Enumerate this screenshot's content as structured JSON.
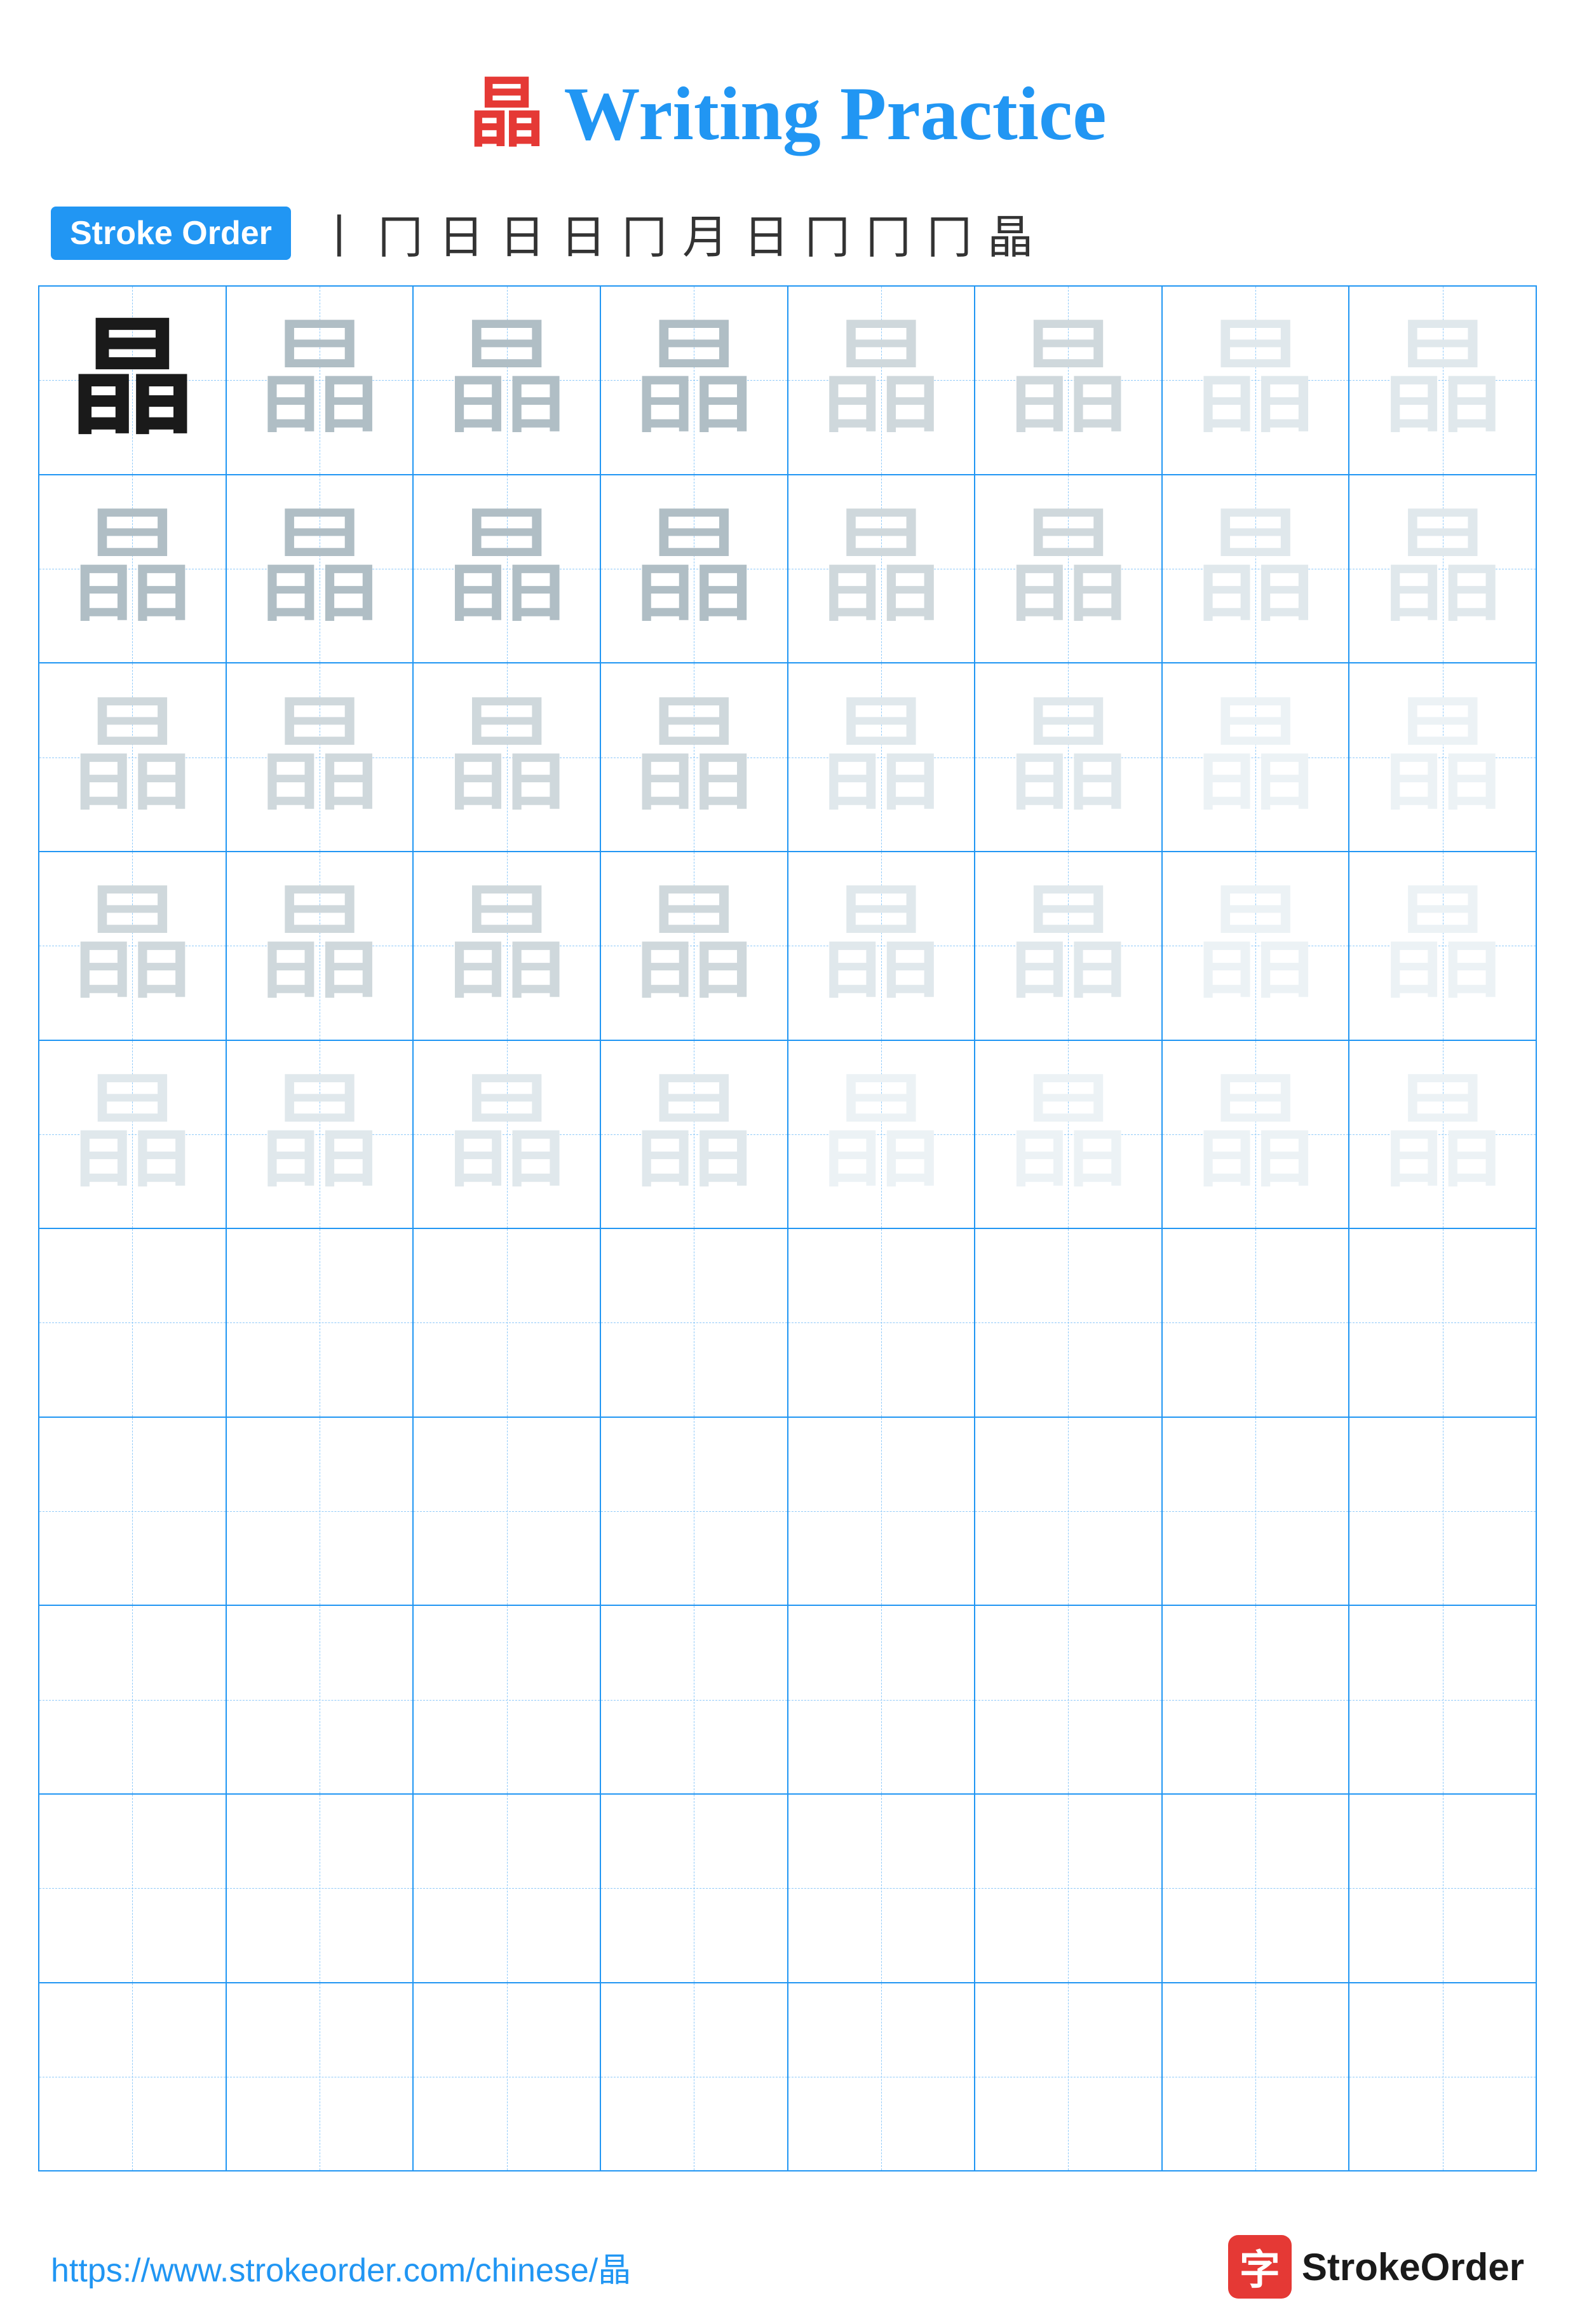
{
  "header": {
    "kanji": "晶",
    "title": "Writing Practice"
  },
  "stroke_order": {
    "badge": "Stroke Order",
    "strokes": [
      "丨",
      "冂",
      "日",
      "日",
      "日",
      "冂",
      "月",
      "日",
      "冂",
      "冂",
      "冂",
      "晶"
    ]
  },
  "footer": {
    "url": "https://www.strokeorder.com/chinese/晶",
    "logo_text": "StrokeOrder",
    "logo_kanji": "字"
  },
  "grid": {
    "rows": 10,
    "cols": 8,
    "char": "晶"
  }
}
